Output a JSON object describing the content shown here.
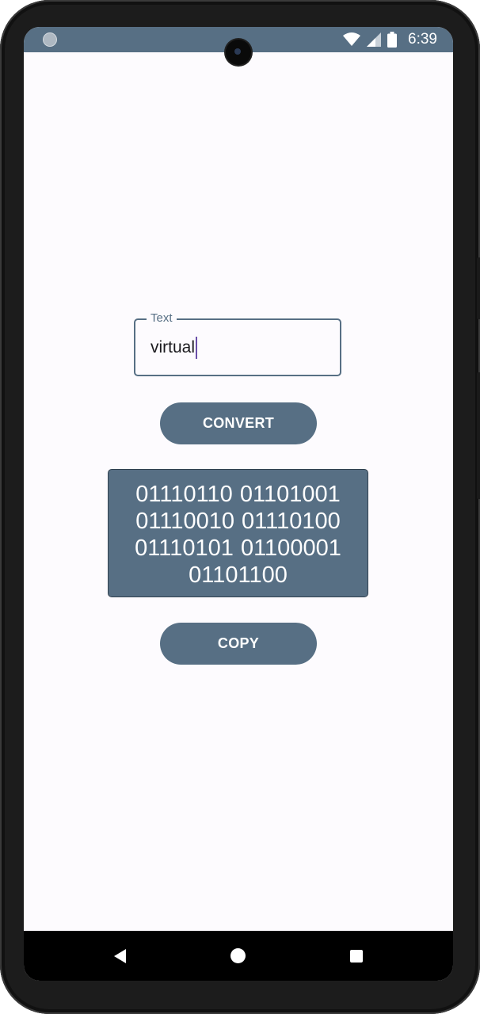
{
  "status_bar": {
    "time": "6:39",
    "icons": [
      "circle-icon",
      "wifi-icon",
      "signal-icon",
      "battery-icon"
    ],
    "background_color": "#576f84"
  },
  "text_field": {
    "label": "Text",
    "value": "virtual"
  },
  "convert_button": {
    "label": "CONVERT"
  },
  "output": {
    "lines": [
      "01110110 01101001",
      "01110010 01110100",
      "01110101 01100001",
      "01101100"
    ]
  },
  "copy_button": {
    "label": "COPY"
  },
  "nav_bar": {
    "icons": [
      "back-icon",
      "home-icon",
      "recents-icon"
    ]
  },
  "colors": {
    "accent": "#576f84",
    "screen_background": "#fdfbfe",
    "caret": "#6a4fa8"
  }
}
